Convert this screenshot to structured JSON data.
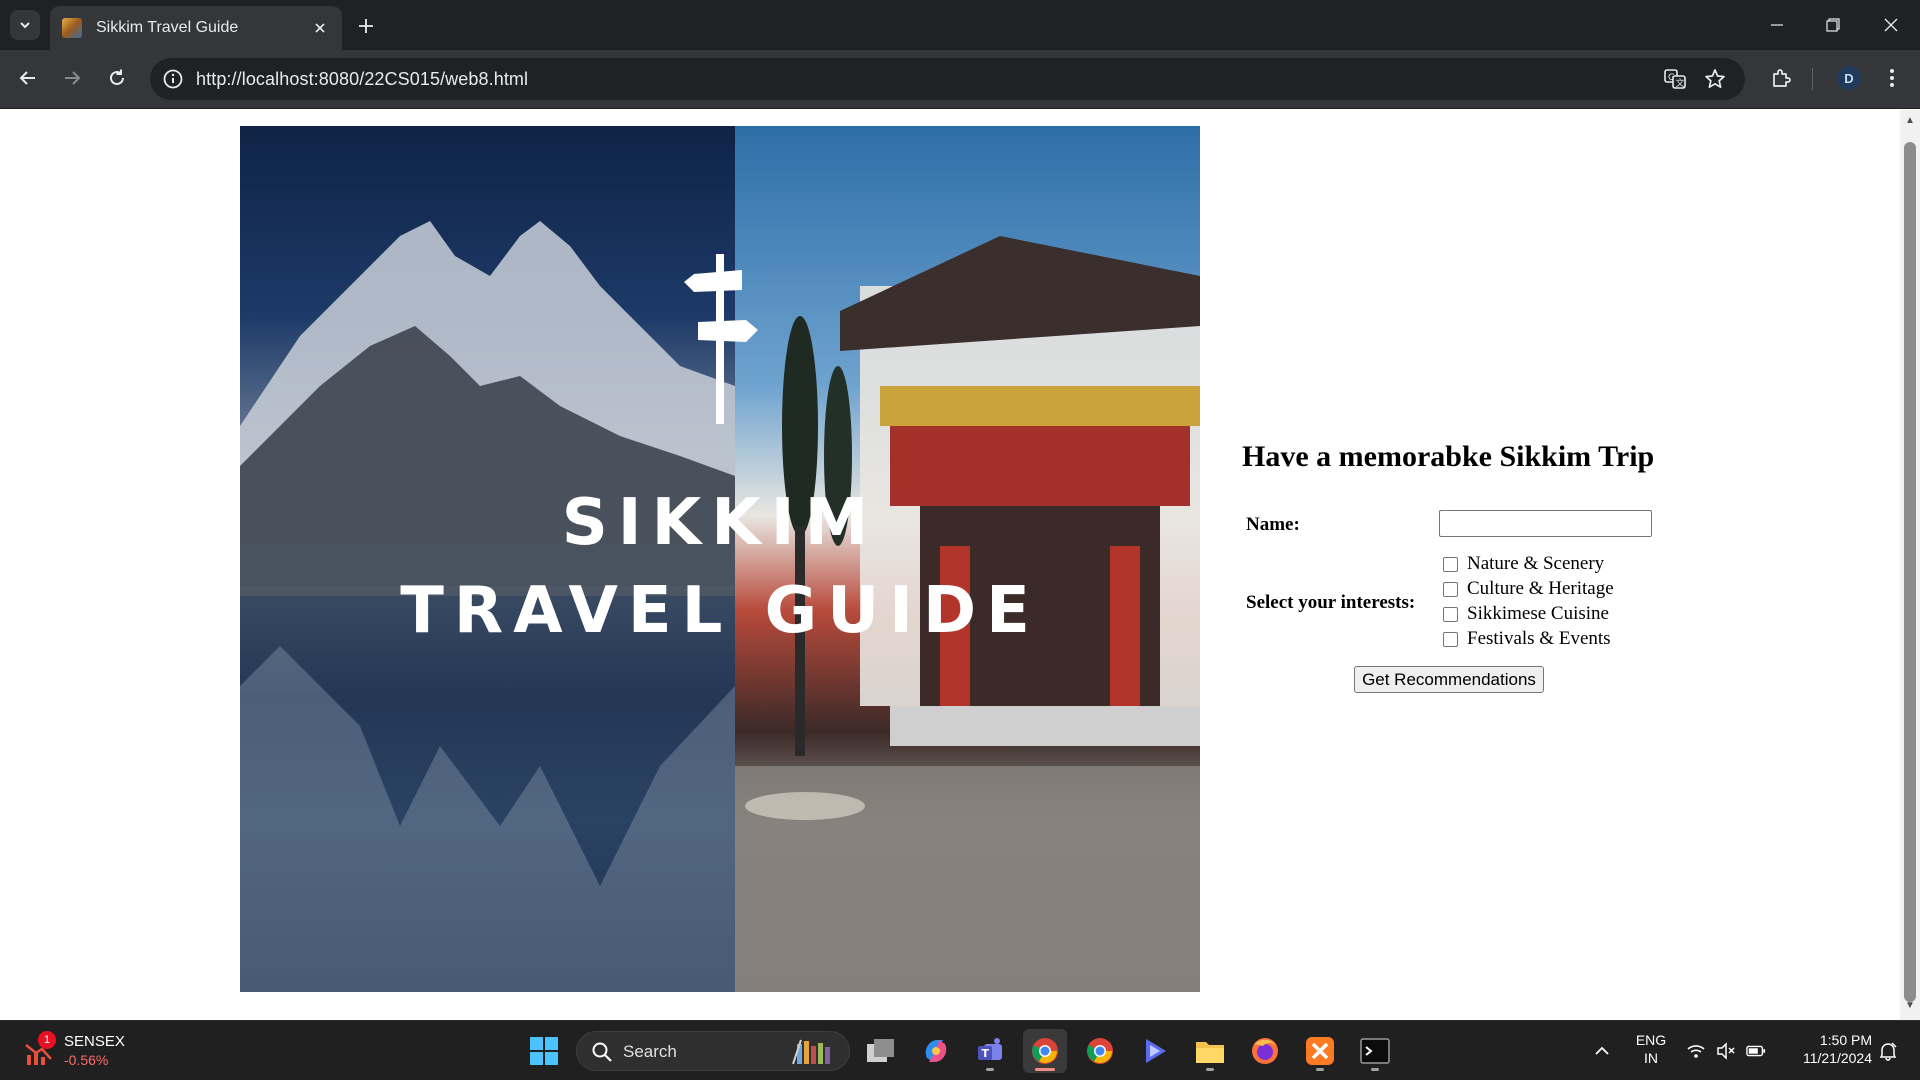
{
  "browser": {
    "tab": {
      "title": "Sikkim Travel Guide",
      "favicon": "sikkim-favicon"
    },
    "address": {
      "url": "http://localhost:8080/22CS015/web8.html"
    },
    "profile_initial": "D"
  },
  "page": {
    "hero": {
      "line1": "SIKKIM",
      "line2": "TRAVEL GUIDE"
    },
    "form": {
      "heading": "Have a memorabke Sikkim Trip",
      "name_label": "Name:",
      "name_value": "",
      "interests_label": "Select your interests:",
      "interests": [
        {
          "label": "Nature & Scenery",
          "checked": false
        },
        {
          "label": "Culture & Heritage",
          "checked": false
        },
        {
          "label": "Sikkimese Cuisine",
          "checked": false
        },
        {
          "label": "Festivals & Events",
          "checked": false
        }
      ],
      "submit_label": "Get Recommendations"
    }
  },
  "taskbar": {
    "widget": {
      "badge": "1",
      "name": "SENSEX",
      "value": "-0.56%"
    },
    "search_placeholder": "Search",
    "language": {
      "line1": "ENG",
      "line2": "IN"
    },
    "clock": {
      "time": "1:50 PM",
      "date": "11/21/2024"
    }
  },
  "colors": {
    "chrome_dark": "#202124",
    "chrome_toolbar": "#35363a",
    "taskbar": "#202020",
    "sensex_negative": "#ff6b6b"
  }
}
